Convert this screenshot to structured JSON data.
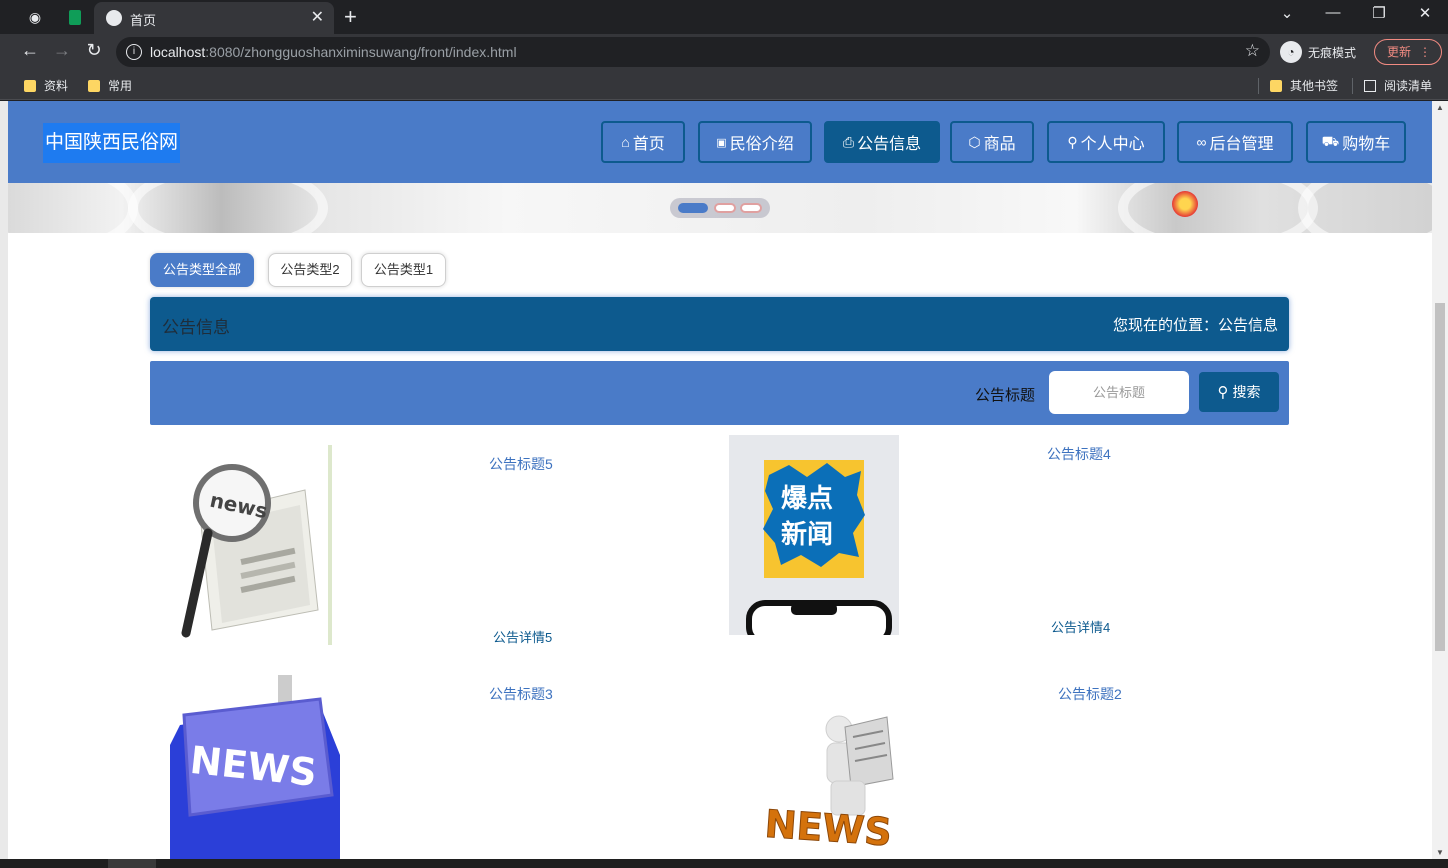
{
  "browser": {
    "tab_title": "首页",
    "url_host": "localhost",
    "url_rest": ":8080/zhongguoshanximinsuwang/front/index.html",
    "incognito_label": "无痕模式",
    "update_label": "更新",
    "bookmarks": [
      "资料",
      "常用"
    ],
    "other_bookmarks": "其他书签",
    "reading_list": "阅读清单"
  },
  "site": {
    "logo": "中国陕西民俗网",
    "nav": [
      {
        "label": "首页",
        "icon": "home-icon",
        "glyph": "⌂"
      },
      {
        "label": "民俗介绍",
        "icon": "gift-icon",
        "glyph": "🎁"
      },
      {
        "label": "公告信息",
        "icon": "printer-icon",
        "glyph": "⎙"
      },
      {
        "label": "商品",
        "icon": "box-icon",
        "glyph": "⬡"
      },
      {
        "label": "个人中心",
        "icon": "user-icon",
        "glyph": "⚇"
      },
      {
        "label": "后台管理",
        "icon": "link-icon",
        "glyph": "🔗"
      },
      {
        "label": "购物车",
        "icon": "cart-icon",
        "glyph": "🛒"
      }
    ],
    "active_nav": "公告信息"
  },
  "filters": [
    "公告类型全部",
    "公告类型2",
    "公告类型1"
  ],
  "section": {
    "title": "公告信息",
    "location": "您现在的位置：公告信息"
  },
  "search": {
    "label": "公告标题",
    "placeholder": "公告标题",
    "button": "搜索"
  },
  "notices": [
    {
      "title": "公告标题5",
      "detail": "公告详情5",
      "image": "news-magnifier"
    },
    {
      "title": "公告标题4",
      "detail": "公告详情4",
      "image": "breaking-news-phone",
      "image_text": "爆点新闻"
    },
    {
      "title": "公告标题3",
      "detail": "",
      "image": "news-keyboard-key",
      "image_text": "NEWS"
    },
    {
      "title": "公告标题2",
      "detail": "",
      "image": "man-reading-news",
      "image_text": "NEWS"
    }
  ],
  "colors": {
    "header": "#4a7bc8",
    "accent_dark": "#0d5a8e",
    "logo_bg": "#1e7bf0",
    "link": "#3d72bf"
  }
}
